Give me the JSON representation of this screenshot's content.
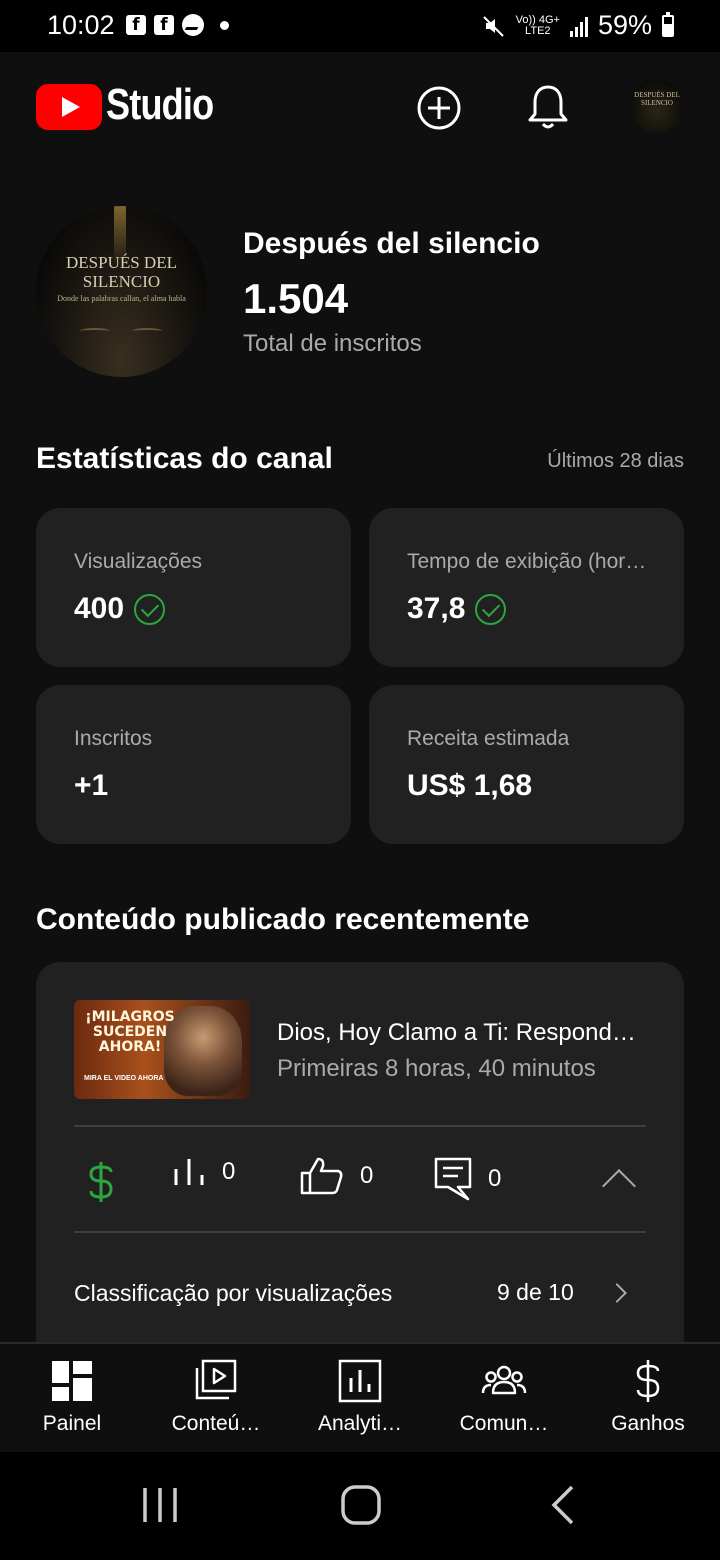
{
  "status_bar": {
    "time": "10:02",
    "network_top": "Vo)) 4G+",
    "network_bottom": "LTE2",
    "battery": "59%"
  },
  "app": {
    "logo_text": "Studio",
    "colors": {
      "brand_red": "#ff0000",
      "background": "#0f0f0f",
      "card": "#212121",
      "secondary_text": "#aaaaaa",
      "check_green": "#2ba640"
    }
  },
  "header": {
    "icons": [
      "create-icon",
      "bell-icon",
      "avatar"
    ],
    "avatar_text": "DESPUÉS DEL SILENCIO"
  },
  "channel": {
    "avatar_title": "DESPUÉS DEL SILENCIO",
    "avatar_tagline": "Donde las palabras callan, el alma habla",
    "name": "Después del silencio",
    "subscribers": "1.504",
    "subscribers_label": "Total de inscritos"
  },
  "stats": {
    "title": "Estatísticas do canal",
    "period": "Últimos 28 dias",
    "cards": [
      {
        "label": "Visualizações",
        "value": "400",
        "check": true
      },
      {
        "label": "Tempo de exibição (horas)",
        "value": "37,8",
        "check": true
      },
      {
        "label": "Inscritos",
        "value": "+1",
        "check": false
      },
      {
        "label": "Receita estimada",
        "value": "US$ 1,68",
        "check": false
      }
    ]
  },
  "recent": {
    "title": "Conteúdo publicado recentemente",
    "thumb_text": "¡MILAGROS SUCEDEN AHORA!",
    "thumb_subtext": "MIRA EL VIDEO AHORA",
    "video_title": "Dios, Hoy Clamo a Ti: Responde Mi Clamor",
    "video_subtitle": "Primeiras 8 horas, 40 minutos",
    "metrics": {
      "views": "0",
      "likes": "0",
      "comments": "0"
    },
    "rank_label": "Classificação por visualizações",
    "rank_value": "9 de 10"
  },
  "bottom_nav": [
    {
      "label": "Painel",
      "icon": "dashboard-icon"
    },
    {
      "label": "Conteú…",
      "icon": "content-icon"
    },
    {
      "label": "Analyti…",
      "icon": "analytics-icon"
    },
    {
      "label": "Comun…",
      "icon": "community-icon"
    },
    {
      "label": "Ganhos",
      "icon": "earn-icon"
    }
  ]
}
